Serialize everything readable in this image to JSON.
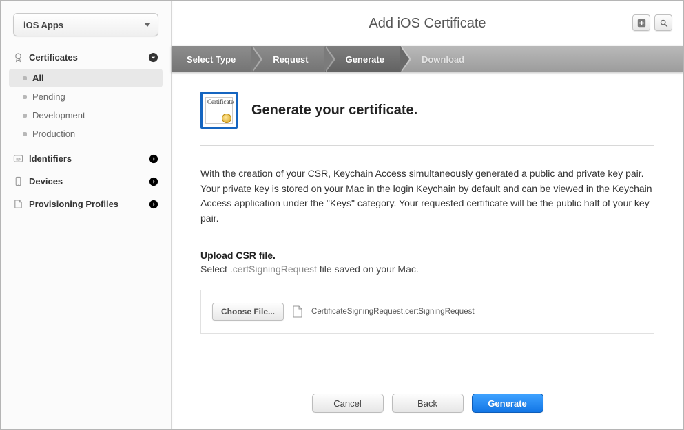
{
  "sidebar": {
    "platform_label": "iOS Apps",
    "groups": [
      {
        "id": "certificates",
        "label": "Certificates",
        "expanded": true,
        "children": [
          {
            "id": "all",
            "label": "All",
            "selected": true
          },
          {
            "id": "pending",
            "label": "Pending",
            "selected": false
          },
          {
            "id": "development",
            "label": "Development",
            "selected": false
          },
          {
            "id": "production",
            "label": "Production",
            "selected": false
          }
        ]
      },
      {
        "id": "identifiers",
        "label": "Identifiers",
        "expanded": false
      },
      {
        "id": "devices",
        "label": "Devices",
        "expanded": false
      },
      {
        "id": "provisioning",
        "label": "Provisioning Profiles",
        "expanded": false
      }
    ]
  },
  "header": {
    "title": "Add iOS Certificate"
  },
  "stepper": {
    "steps": [
      {
        "id": "select-type",
        "label": "Select Type",
        "state": "done"
      },
      {
        "id": "request",
        "label": "Request",
        "state": "done"
      },
      {
        "id": "generate",
        "label": "Generate",
        "state": "active"
      },
      {
        "id": "download",
        "label": "Download",
        "state": "disabled"
      }
    ]
  },
  "content": {
    "section_title": "Generate your certificate.",
    "body_text": "With the creation of your CSR, Keychain Access simultaneously generated a public and private key pair. Your private key is stored on your Mac in the login Keychain by default and can be viewed in the Keychain Access application under the \"Keys\" category. Your requested certificate will be the public half of your key pair.",
    "upload_heading": "Upload CSR file.",
    "upload_hint_prefix": "Select ",
    "upload_hint_ext": ".certSigningRequest",
    "upload_hint_suffix": " file saved on your Mac.",
    "choose_file_label": "Choose File...",
    "selected_file_name": "CertificateSigningRequest.certSigningRequest"
  },
  "footer": {
    "cancel": "Cancel",
    "back": "Back",
    "generate": "Generate"
  }
}
